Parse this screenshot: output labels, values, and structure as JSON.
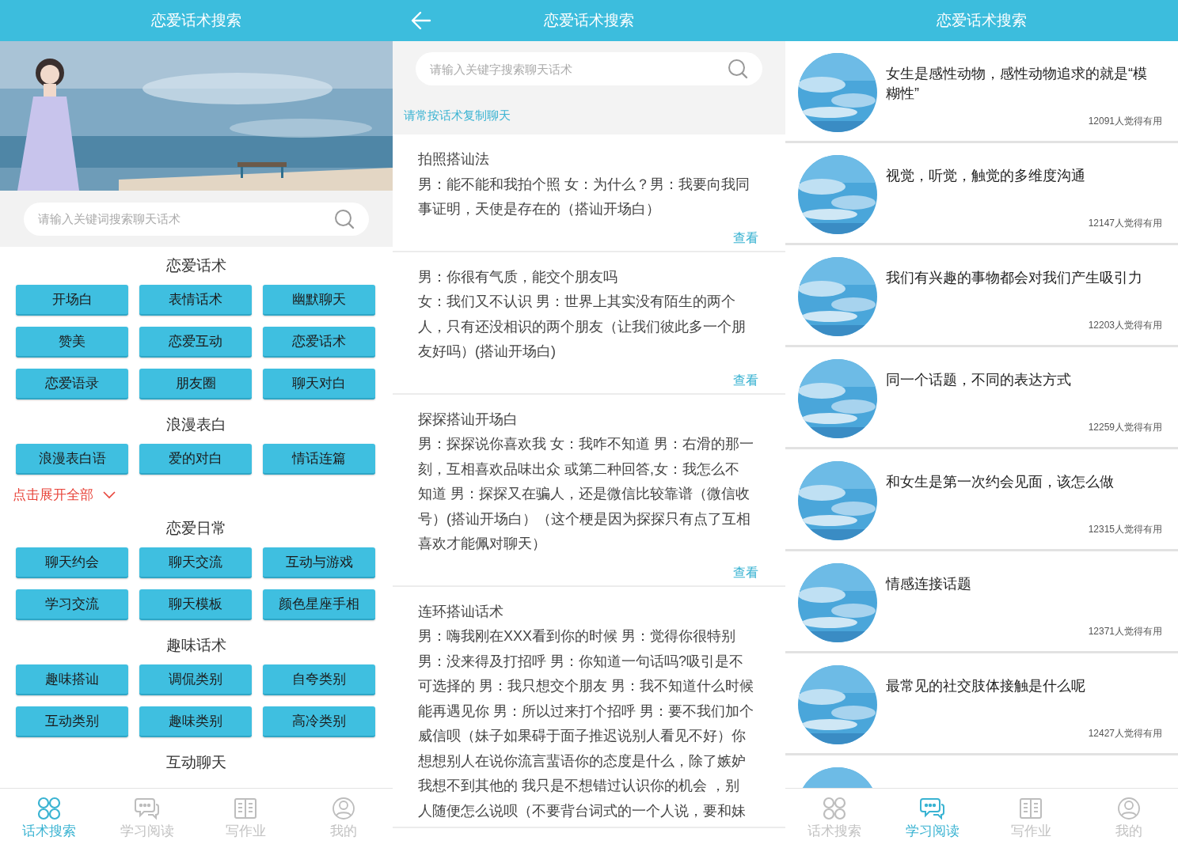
{
  "search_screen": {
    "title": "恋爱话术搜索",
    "search": {
      "placeholder": "请输入关键词搜索聊天话术"
    },
    "sections": [
      {
        "title": "恋爱话术",
        "buttons": [
          "开场白",
          "表情话术",
          "幽默聊天",
          "赞美",
          "恋爱互动",
          "恋爱话术",
          "恋爱语录",
          "朋友圈",
          "聊天对白"
        ]
      },
      {
        "title": "浪漫表白",
        "buttons": [
          "浪漫表白语",
          "爱的对白",
          "情话连篇"
        ],
        "expand_link": "点击展开全部"
      },
      {
        "title": "恋爱日常",
        "buttons": [
          "聊天约会",
          "聊天交流",
          "互动与游戏",
          "学习交流",
          "聊天模板",
          "颜色星座手相"
        ]
      },
      {
        "title": "趣味话术",
        "buttons": [
          "趣味搭讪",
          "调侃类别",
          "自夸类别",
          "互动类别",
          "趣味类别",
          "高冷类别"
        ]
      },
      {
        "title": "互动聊天"
      }
    ],
    "tabs": [
      {
        "label": "话术搜索",
        "selected": true
      },
      {
        "label": "学习阅读",
        "selected": false
      },
      {
        "label": "写作业",
        "selected": false
      },
      {
        "label": "我的",
        "selected": false
      }
    ]
  },
  "script_list_screen": {
    "title": "恋爱话术搜索",
    "search": {
      "placeholder": "请输入关键字搜索聊天话术"
    },
    "hint": "请常按话术复制聊天",
    "cards": [
      {
        "title": "拍照搭讪法",
        "lines": [
          "男：能不能和我拍个照 女：为什么？男：我要向我同",
          "事证明，天使是存在的（搭讪开场白）"
        ],
        "link": "查看"
      },
      {
        "lines": [
          "男：你很有气质，能交个朋友吗",
          "女：我们又不认识 男：世界上其实没有陌生的两个",
          "人，只有还没相识的两个朋友（让我们彼此多一个朋",
          "友好吗）(搭讪开场白)"
        ],
        "link": "查看"
      },
      {
        "title": "探探搭讪开场白",
        "lines": [
          "男：探探说你喜欢我 女：我咋不知道 男：右滑的那一",
          "刻，互相喜欢品味出众 或第二种回答,女：我怎么不",
          "知道 男：探探又在骗人，还是微信比较靠谱（微信收",
          "号）(搭讪开场白）（这个梗是因为探探只有点了互相",
          "喜欢才能佩对聊天）"
        ],
        "link": "查看"
      },
      {
        "title": "连环搭讪话术",
        "lines": [
          "男：嗨我刚在XXX看到你的时候 男：觉得你很特别",
          "男：没来得及打招呼 男：你知道一句话吗?吸引是不",
          "可选择的 男：我只想交个朋友 男：我不知道什么时候",
          "能再遇见你 男：所以过来打个招呼 男：要不我们加个",
          "威信呗（妹子如果碍于面子推迟说别人看见不好）你",
          "想想别人在说你流言蜚语你的态度是什么，除了嫉妒",
          "我想不到其他的 我只是不想错过认识你的机会 ，别",
          "人随便怎么说呗（不要背台词式的一个人说，要和妹"
        ]
      }
    ]
  },
  "reading_screen": {
    "title": "恋爱话术搜索",
    "articles": [
      {
        "title": "女生是感性动物，感性动物追求的就是“模糊性”",
        "count": "12091人觉得有用"
      },
      {
        "title": "视觉，听觉，触觉的多维度沟通",
        "count": "12147人觉得有用"
      },
      {
        "title": "我们有兴趣的事物都会对我们产生吸引力",
        "count": "12203人觉得有用"
      },
      {
        "title": "同一个话题，不同的表达方式",
        "count": "12259人觉得有用"
      },
      {
        "title": "和女生是第一次约会见面，该怎么做",
        "count": "12315人觉得有用"
      },
      {
        "title": "情感连接话题",
        "count": "12371人觉得有用"
      },
      {
        "title": "最常见的社交肢体接触是什么呢",
        "count": "12427人觉得有用"
      }
    ],
    "tabs": [
      {
        "label": "话术搜索",
        "selected": false
      },
      {
        "label": "学习阅读",
        "selected": true
      },
      {
        "label": "写作业",
        "selected": false
      },
      {
        "label": "我的",
        "selected": false
      }
    ]
  }
}
